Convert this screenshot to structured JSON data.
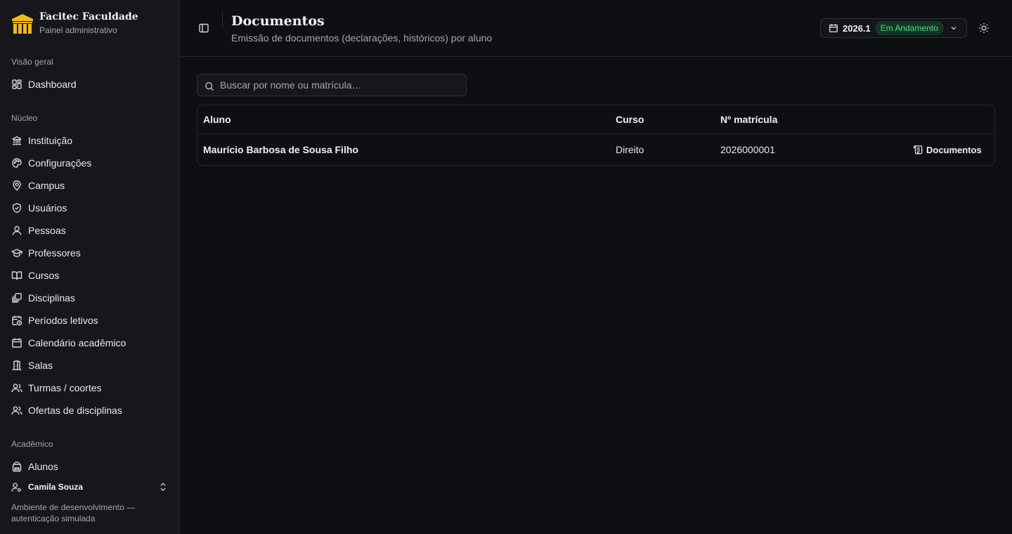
{
  "brand": {
    "name": "Facitec Faculdade",
    "subtitle": "Painel administrativo"
  },
  "sidebar": {
    "sections": [
      {
        "heading": "Visão geral",
        "items": [
          {
            "label": "Dashboard",
            "icon": "dashboard-icon"
          }
        ]
      },
      {
        "heading": "Núcleo",
        "items": [
          {
            "label": "Instituição",
            "icon": "landmark-icon"
          },
          {
            "label": "Configurações",
            "icon": "palette-icon"
          },
          {
            "label": "Campus",
            "icon": "map-pin-icon"
          },
          {
            "label": "Usuários",
            "icon": "shield-icon"
          },
          {
            "label": "Pessoas",
            "icon": "user-icon"
          },
          {
            "label": "Professores",
            "icon": "graduation-cap-icon"
          },
          {
            "label": "Cursos",
            "icon": "book-open-icon"
          },
          {
            "label": "Disciplinas",
            "icon": "library-icon"
          },
          {
            "label": "Períodos letivos",
            "icon": "calendar-clock-icon"
          },
          {
            "label": "Calendário acadêmico",
            "icon": "calendar-icon"
          },
          {
            "label": "Salas",
            "icon": "door-icon"
          },
          {
            "label": "Turmas / coortes",
            "icon": "users-icon"
          },
          {
            "label": "Ofertas de disciplinas",
            "icon": "users-icon"
          }
        ]
      },
      {
        "heading": "Acadêmico",
        "items": [
          {
            "label": "Alunos",
            "icon": "school-bag-icon"
          }
        ]
      }
    ]
  },
  "user": {
    "name": "Camila Souza"
  },
  "environment_note": "Ambiente de desenvolvimento — autenticação simulada",
  "header": {
    "title": "Documentos",
    "subtitle": "Emissão de documentos (declarações, históricos) por aluno",
    "period": "2026.1",
    "period_status": "Em Andamento"
  },
  "search": {
    "placeholder": "Buscar por nome ou matrícula…",
    "value": ""
  },
  "table": {
    "columns": [
      "Aluno",
      "Curso",
      "Nº matrícula"
    ],
    "rows": [
      {
        "aluno": "Maurício Barbosa de Sousa Filho",
        "curso": "Direito",
        "matricula": "2026000001",
        "action": "Documentos"
      }
    ]
  },
  "colors": {
    "background": "#0e0f12",
    "sidebar": "#15171c",
    "accent": "#f5b90f",
    "status_badge_bg": "#143524",
    "status_badge_text": "#4ade80"
  }
}
